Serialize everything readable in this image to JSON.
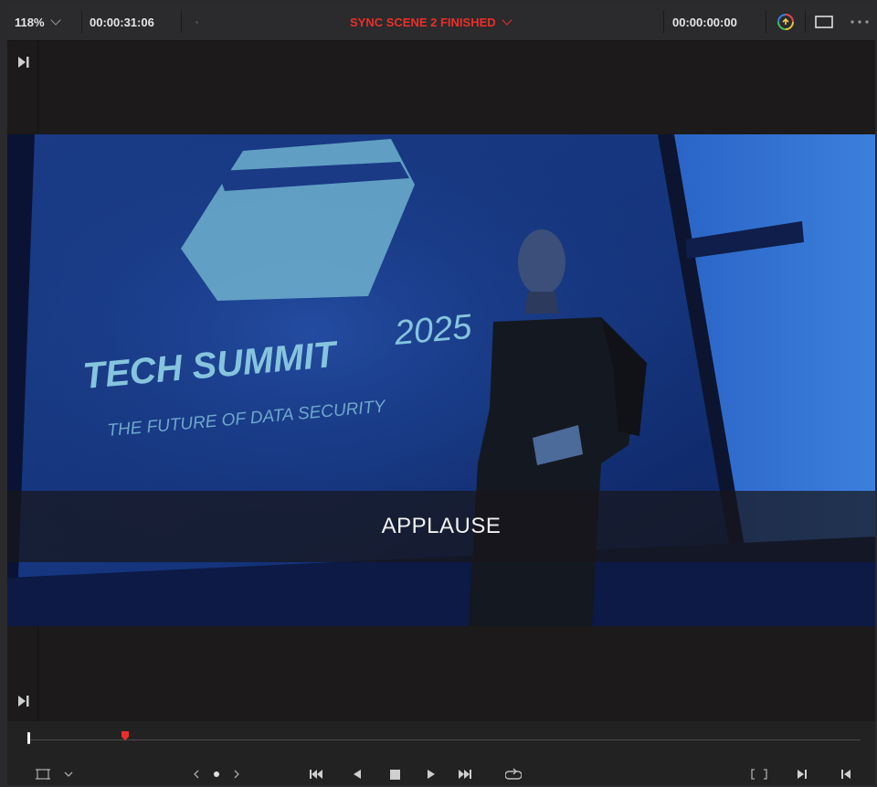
{
  "topbar": {
    "zoom": "118%",
    "source_timecode": "00:00:31:06",
    "clip_title": "SYNC SCENE 2 FINISHED",
    "record_timecode": "00:00:00:00",
    "icons": [
      "chevron-down-icon",
      "color-wheel-icon",
      "viewer-mode-icon",
      "more-options-icon"
    ]
  },
  "viewer": {
    "caption": "APPLAUSE",
    "slide": {
      "headline": "TECH SUMMIT",
      "year": "2025",
      "tagline": "THE FUTURE OF DATA SECURITY"
    }
  },
  "transport": {
    "playhead_marker_color": "#e8302a",
    "icons": [
      "safe-area-icon",
      "chevron-down-icon",
      "prev-clip-icon",
      "dot-icon",
      "next-clip-icon",
      "jump-to-start-icon",
      "reverse-play-icon",
      "stop-icon",
      "play-icon",
      "jump-to-end-icon",
      "loop-icon",
      "match-frame-icon",
      "mark-in-icon",
      "mark-out-icon"
    ]
  },
  "colors": {
    "accent": "#e8302a",
    "panel": "#2b2a2c",
    "background": "#1c1a1a"
  }
}
